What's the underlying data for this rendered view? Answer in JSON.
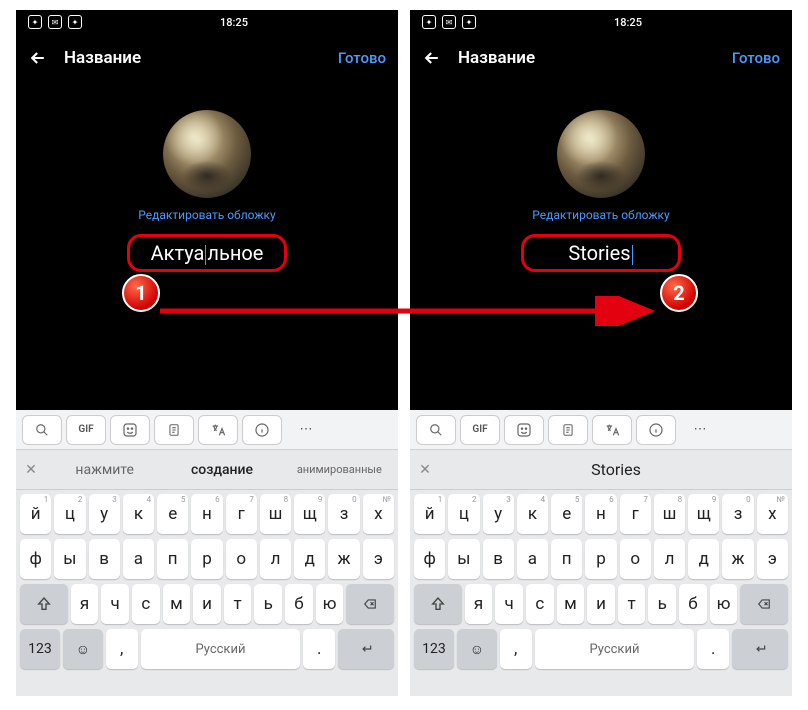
{
  "status": {
    "time": "18:25"
  },
  "header": {
    "title": "Название",
    "done": "Готово"
  },
  "editor": {
    "edit_cover": "Редактировать обложку",
    "name_left_pre": "Актуа",
    "name_left_post": "льное",
    "name_right": "Stories"
  },
  "suggestions": {
    "s1": "нажмите",
    "s2": "создание",
    "s3": "анимированные",
    "single": "Stories"
  },
  "keyboard": {
    "row1": [
      {
        "k": "й",
        "h": "1"
      },
      {
        "k": "ц",
        "h": "2"
      },
      {
        "k": "у",
        "h": "3"
      },
      {
        "k": "к",
        "h": "4"
      },
      {
        "k": "е",
        "h": "5"
      },
      {
        "k": "н",
        "h": "6"
      },
      {
        "k": "г",
        "h": "7"
      },
      {
        "k": "ш",
        "h": "8"
      },
      {
        "k": "щ",
        "h": "9"
      },
      {
        "k": "з",
        "h": "0"
      },
      {
        "k": "х",
        "h": "№"
      }
    ],
    "row2": [
      {
        "k": "ф"
      },
      {
        "k": "ы"
      },
      {
        "k": "в"
      },
      {
        "k": "а"
      },
      {
        "k": "п"
      },
      {
        "k": "р"
      },
      {
        "k": "о"
      },
      {
        "k": "л"
      },
      {
        "k": "д"
      },
      {
        "k": "ж"
      },
      {
        "k": "э"
      }
    ],
    "row3": [
      {
        "k": "я"
      },
      {
        "k": "ч"
      },
      {
        "k": "с"
      },
      {
        "k": "м"
      },
      {
        "k": "и"
      },
      {
        "k": "т"
      },
      {
        "k": "ь"
      },
      {
        "k": "б"
      },
      {
        "k": "ю"
      }
    ],
    "bottom": {
      "num": "123",
      "lang": "Русский"
    },
    "toolbar_gif": "GIF"
  },
  "badges": {
    "b1": "1",
    "b2": "2"
  }
}
